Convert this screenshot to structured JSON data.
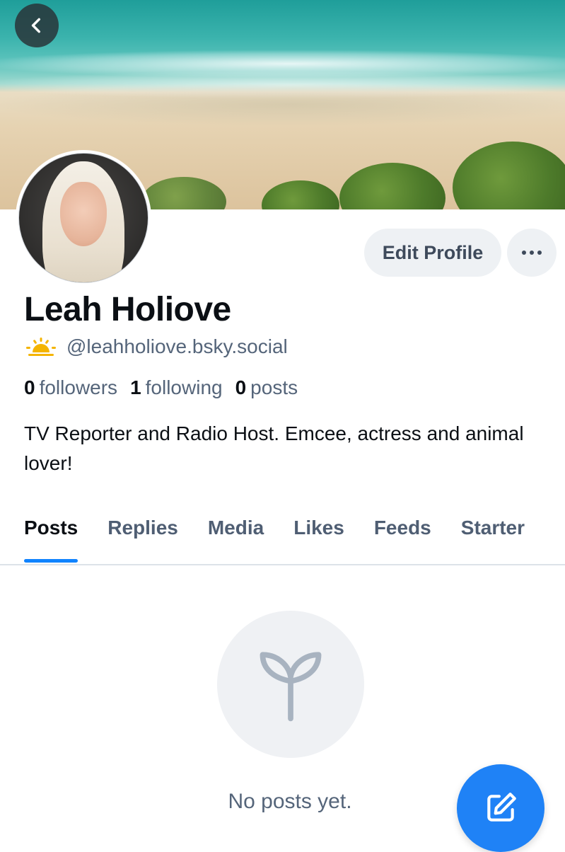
{
  "profile": {
    "display_name": "Leah Holiove",
    "handle": "@leahholiove.bsky.social",
    "bio": "TV Reporter and Radio Host. Emcee, actress and animal lover!",
    "stats": {
      "followers_count": "0",
      "followers_label": "followers",
      "following_count": "1",
      "following_label": "following",
      "posts_count": "0",
      "posts_label": "posts"
    }
  },
  "header": {
    "back_icon": "chevron-left-icon",
    "edit_profile_label": "Edit Profile",
    "more_icon": "ellipsis-icon"
  },
  "tabs": [
    {
      "label": "Posts",
      "active": true
    },
    {
      "label": "Replies",
      "active": false
    },
    {
      "label": "Media",
      "active": false
    },
    {
      "label": "Likes",
      "active": false
    },
    {
      "label": "Feeds",
      "active": false
    },
    {
      "label": "Starter",
      "active": false
    }
  ],
  "empty_state": {
    "icon": "seedling-icon",
    "message": "No posts yet."
  },
  "fab": {
    "icon": "compose-icon"
  },
  "colors": {
    "accent": "#1083fe",
    "fab": "#1f82f6",
    "muted_text": "#55657a",
    "button_bg": "#eef1f4",
    "sun_emoji": "#f4b400"
  }
}
